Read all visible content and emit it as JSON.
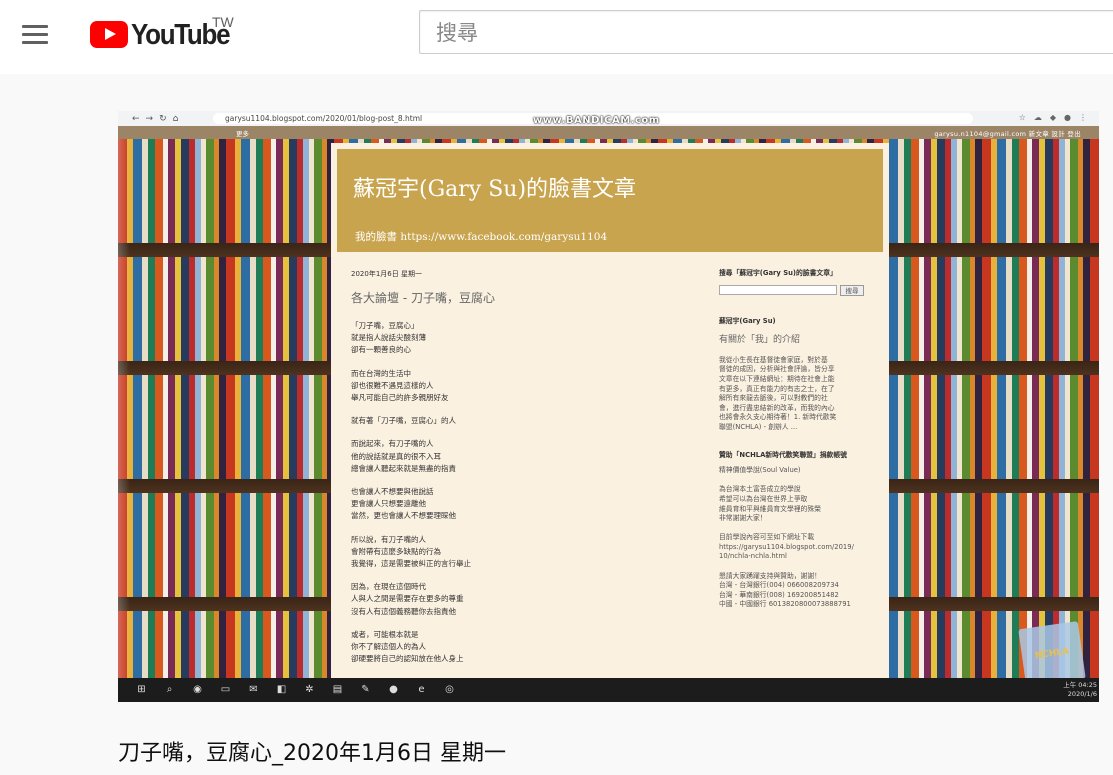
{
  "masthead": {
    "logo_text": "YouTube",
    "country_code": "TW",
    "search_placeholder": "搜尋"
  },
  "browser": {
    "url": "garysu1104.blogspot.com/2020/01/blog-post_8.html",
    "recorder_watermark": "www.BANDICAM.com",
    "bookmark_more": "更多",
    "account_links": "garysu.n1104@gmail.com   新文章   設計   登出"
  },
  "blog": {
    "title": "蘇冠宇(Gary Su)的臉書文章",
    "subtitle": "我的臉書 https://www.facebook.com/garysu1104",
    "post": {
      "date": "2020年1月6日 星期一",
      "title": "各大論壇 - 刀子嘴，豆腐心",
      "paragraphs": [
        [
          "「刀子嘴，豆腐心」",
          "就是指人說話尖酸刻薄",
          "卻有一顆善良的心"
        ],
        [
          "而在台灣的生活中",
          "卻也很難不遇見這樣的人",
          "舉凡可能自己的許多親朋好友"
        ],
        [
          "就有著「刀子嘴，豆腐心」的人"
        ],
        [
          "而說起來，有刀子嘴的人",
          "他的說話就是真的很不入耳",
          "總會讓人聽起來就是無盡的指責"
        ],
        [
          "也會讓人不想要與他說話",
          "更會讓人只想要遠離他",
          "當然，更也會讓人不想要理睬他"
        ],
        [
          "所以說，有刀子嘴的人",
          "會附帶有這麼多缺點的行為",
          "我覺得，這是需要被糾正的言行舉止"
        ],
        [
          "因為，在現在這個時代",
          "人與人之間是需要存在更多的尊重",
          "沒有人有這個義務聽你去指責他"
        ],
        [
          "或者，可能根本就是",
          "你不了解這個人的為人",
          "卻硬要將自己的認知放在他人身上"
        ]
      ]
    },
    "sidebar": {
      "search_heading": "搜尋「蘇冠宇(Gary Su)的臉書文章」",
      "search_button": "搜尋",
      "profile_heading": "蘇冠宇(Gary Su)",
      "about_title": "有關於「我」的介紹",
      "about_lines": [
        "我從小生長在基督徒會家庭，對於基",
        "督徒的成因，分析與社會評論，皆分享",
        "文章在以下連結網址：期待在社會上能",
        "有更多，真正有能力的有志之士，在了",
        "解所有來龍去脈後，可以對教們的社",
        "會，進行盡忠結新的改革，而我的內心",
        "也將會永久支心期待著！1. 新時代歡笑",
        "聯盟(NCHLA) - 創辦人 ..."
      ],
      "sponsor_heading": "贊助「NCHLA新時代歡笑聯盟」捐款帳號",
      "sponsor_lines": [
        "精神價值學說(Soul Value)",
        "",
        "為台灣本土富吾成立的學說",
        "希望可以為台灣在世界上爭取",
        "維員育和平與維員育文學裡的殊榮",
        "非常謝謝大家！",
        "",
        "目前學說內容可至如下網址下載",
        "https://garysu1104.blogspot.com/2019/",
        "10/nchla-nchla.html",
        "",
        "懇請大家踴躍支持與贊助，謝謝！",
        "台灣 - 台灣銀行(004) 066008209734",
        "台灣 - 華南銀行(008) 169200851482",
        "中國 - 中國銀行 6013820800073888791"
      ]
    }
  },
  "taskbar": {
    "icons": [
      "windows-start-icon",
      "search-icon",
      "chrome-icon",
      "file-explorer-icon",
      "outlook-icon",
      "app-icon",
      "settings-icon",
      "notes-icon",
      "paint-icon",
      "line-icon",
      "ie-icon",
      "record-icon"
    ],
    "time": "上午 04:25",
    "date": "2020/1/6"
  },
  "overlay": {
    "channel_watermark": "NCHLA"
  },
  "video": {
    "title": "刀子嘴，豆腐心_2020年1月6日 星期一"
  }
}
